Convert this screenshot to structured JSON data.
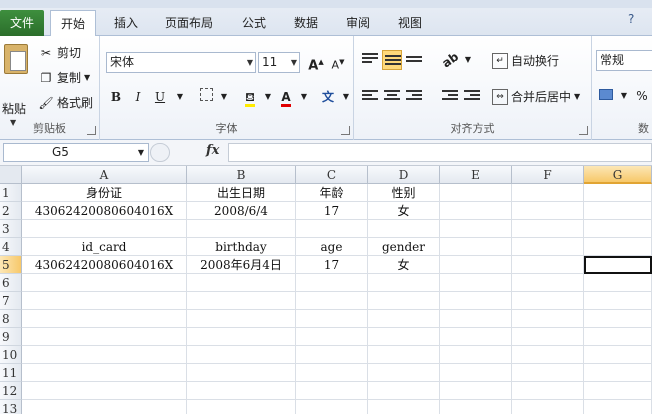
{
  "tabs": [
    {
      "label": "文件"
    },
    {
      "label": "开始"
    },
    {
      "label": "插入"
    },
    {
      "label": "页面布局"
    },
    {
      "label": "公式"
    },
    {
      "label": "数据"
    },
    {
      "label": "审阅"
    },
    {
      "label": "视图"
    }
  ],
  "clipboard": {
    "paste": "粘贴",
    "cut": "剪切",
    "copy": "复制",
    "format_painter": "格式刷",
    "label": "剪贴板"
  },
  "font": {
    "name": "宋体",
    "size": "11",
    "grow": "A",
    "shrink": "A",
    "bold": "B",
    "italic": "I",
    "underline": "U",
    "font_color_letter": "A",
    "phonetic": "文",
    "label": "字体"
  },
  "alignment": {
    "wrap_text": "自动换行",
    "merge_center": "合并后居中",
    "label": "对齐方式"
  },
  "number": {
    "format": "常规",
    "percent": "%",
    "label": "数"
  },
  "formula_bar": {
    "name_box": "G5",
    "fx": "fx",
    "value": ""
  },
  "sheet": {
    "columns": [
      "A",
      "B",
      "C",
      "D",
      "E",
      "F",
      "G"
    ],
    "rows": [
      "1",
      "2",
      "3",
      "4",
      "5",
      "6",
      "7",
      "8",
      "9",
      "10",
      "11",
      "12",
      "13"
    ],
    "cells": {
      "r1": [
        "身份证",
        "出生日期",
        "年龄",
        "性别"
      ],
      "r2": [
        "43062420080604016X",
        "2008/6/4",
        "17",
        "女"
      ],
      "r4": [
        "id_card",
        "birthday",
        "age",
        "gender"
      ],
      "r5": [
        "43062420080604016X",
        "2008年6月4日",
        "17",
        "女"
      ]
    },
    "active_cell": "G5"
  }
}
